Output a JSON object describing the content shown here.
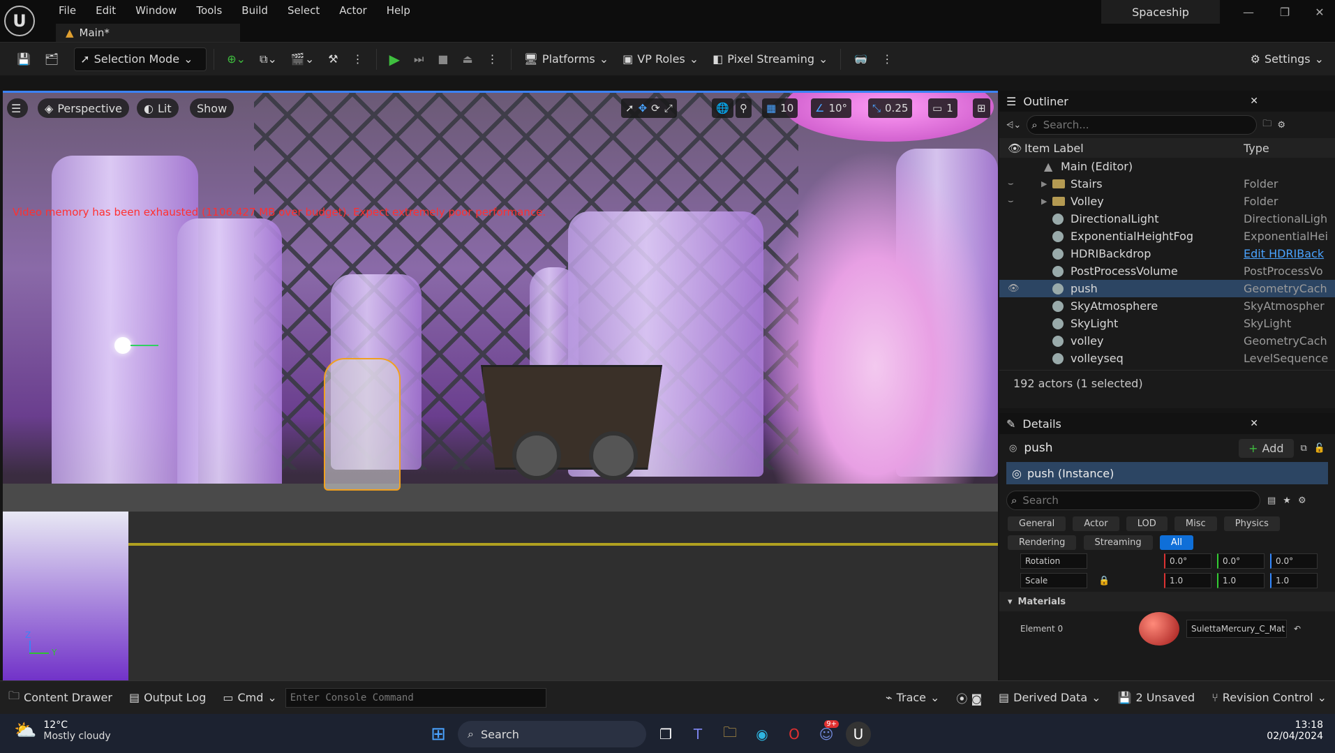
{
  "titlebar": {
    "menu": [
      "File",
      "Edit",
      "Window",
      "Tools",
      "Build",
      "Select",
      "Actor",
      "Help"
    ],
    "project_name": "Spaceship",
    "level_tab": "Main*"
  },
  "toolbar": {
    "selection_mode": "Selection Mode",
    "platforms": "Platforms",
    "vp_roles": "VP Roles",
    "pixel_streaming": "Pixel Streaming",
    "settings": "Settings"
  },
  "viewport": {
    "perspective": "Perspective",
    "lit": "Lit",
    "show": "Show",
    "grid_snap": "10",
    "rotation_snap": "10°",
    "scale_snap": "0.25",
    "camera_speed": "1",
    "warning": "Video memory has been exhausted (1106.427 MB over budget). Expect extremely poor performance.",
    "axis_z": "Z",
    "axis_y": "Y"
  },
  "outliner": {
    "title": "Outliner",
    "search_placeholder": "Search...",
    "col_label": "Item Label",
    "col_type": "Type",
    "root": "Main (Editor)",
    "rows": [
      {
        "label": "Stairs",
        "type": "Folder",
        "kind": "folder"
      },
      {
        "label": "Volley",
        "type": "Folder",
        "kind": "folder"
      },
      {
        "label": "DirectionalLight",
        "type": "DirectionalLigh",
        "kind": "actor"
      },
      {
        "label": "ExponentialHeightFog",
        "type": "ExponentialHei",
        "kind": "actor"
      },
      {
        "label": "HDRIBackdrop",
        "type": "Edit HDRIBack",
        "kind": "actor"
      },
      {
        "label": "PostProcessVolume",
        "type": "PostProcessVo",
        "kind": "actor"
      },
      {
        "label": "push",
        "type": "GeometryCach",
        "kind": "actor"
      },
      {
        "label": "SkyAtmosphere",
        "type": "SkyAtmospher",
        "kind": "actor"
      },
      {
        "label": "SkyLight",
        "type": "SkyLight",
        "kind": "actor"
      },
      {
        "label": "volley",
        "type": "GeometryCach",
        "kind": "actor"
      },
      {
        "label": "volleyseq",
        "type": "LevelSequence",
        "kind": "actor"
      }
    ],
    "status": "192 actors (1 selected)"
  },
  "details": {
    "title": "Details",
    "actor_name": "push",
    "add_label": "Add",
    "instance": "push (Instance)",
    "search_placeholder": "Search",
    "filters": [
      "General",
      "Actor",
      "LOD",
      "Misc",
      "Physics",
      "Rendering",
      "Streaming",
      "All"
    ],
    "rotation_label": "Rotation",
    "rotation": [
      "0.0°",
      "0.0°",
      "0.0°"
    ],
    "scale_label": "Scale",
    "scale": [
      "1.0",
      "1.0",
      "1.0"
    ],
    "materials_label": "Materials",
    "element_label": "Element 0",
    "material_name": "SulettaMercury_C_Mat"
  },
  "bottombar": {
    "content_drawer": "Content Drawer",
    "output_log": "Output Log",
    "cmd": "Cmd",
    "console_placeholder": "Enter Console Command",
    "trace": "Trace",
    "derived_data": "Derived Data",
    "unsaved": "2 Unsaved",
    "revision_control": "Revision Control"
  },
  "taskbar": {
    "temperature": "12°C",
    "weather": "Mostly cloudy",
    "search": "Search",
    "time": "13:18",
    "date": "02/04/2024",
    "discord_badge": "9+"
  },
  "colors": {
    "accent_blue": "#0f6fd8",
    "selection_row": "#2c4563",
    "warning_red": "#ff3030",
    "play_green": "#3fbf3f"
  }
}
